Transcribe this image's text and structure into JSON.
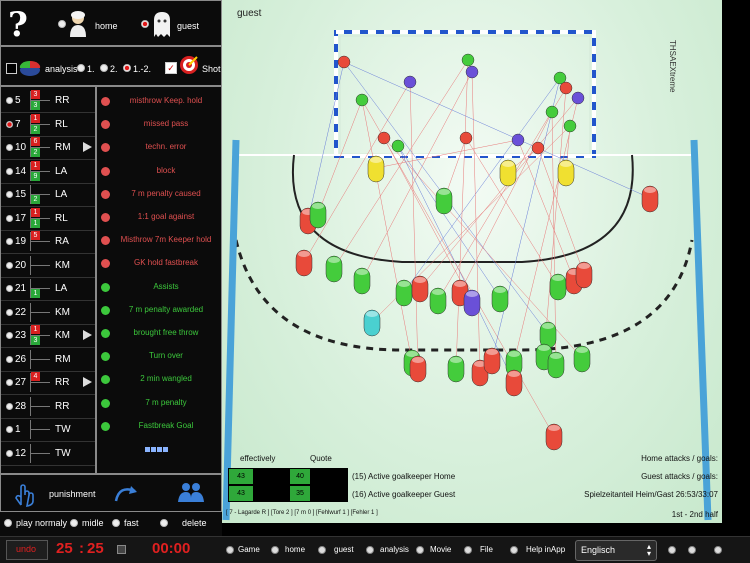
{
  "top": {
    "home_label": "home",
    "guest_label": "guest"
  },
  "options": {
    "analysis_label": "analysis",
    "opt1": "1.",
    "opt2": "2.",
    "opt3": "1.-2.",
    "shot_label": "Shot"
  },
  "players": [
    {
      "num": "5",
      "pos": "RR",
      "c1": "3",
      "c2": "3"
    },
    {
      "num": "7",
      "pos": "RL",
      "c1": "1",
      "c2": "2"
    },
    {
      "num": "10",
      "pos": "RM",
      "c1": "6",
      "c2": "2"
    },
    {
      "num": "14",
      "pos": "LA",
      "c1": "1",
      "c2": "9"
    },
    {
      "num": "15",
      "pos": "LA",
      "c1": "",
      "c2": "2"
    },
    {
      "num": "17",
      "pos": "RL",
      "c1": "1",
      "c2": "1"
    },
    {
      "num": "19",
      "pos": "RA",
      "c1": "5",
      "c2": ""
    },
    {
      "num": "20",
      "pos": "KM",
      "c1": "",
      "c2": ""
    },
    {
      "num": "21",
      "pos": "LA",
      "c1": "",
      "c2": "1"
    },
    {
      "num": "22",
      "pos": "KM",
      "c1": "",
      "c2": ""
    },
    {
      "num": "23",
      "pos": "KM",
      "c1": "1",
      "c2": "3"
    },
    {
      "num": "26",
      "pos": "RM",
      "c1": "",
      "c2": ""
    },
    {
      "num": "27",
      "pos": "RR",
      "c1": "4",
      "c2": ""
    },
    {
      "num": "28",
      "pos": "RR",
      "c1": "",
      "c2": ""
    },
    {
      "num": "1",
      "pos": "TW",
      "c1": "",
      "c2": ""
    },
    {
      "num": "12",
      "pos": "TW",
      "c1": "",
      "c2": ""
    }
  ],
  "actions": [
    {
      "label": "misthrow Keep. hold",
      "color": "#e05050"
    },
    {
      "label": "missed pass",
      "color": "#e05050"
    },
    {
      "label": "techn. error",
      "color": "#e05050"
    },
    {
      "label": "block",
      "color": "#e05050"
    },
    {
      "label": "7 m penalty caused",
      "color": "#e05050"
    },
    {
      "label": "1:1 goal against",
      "color": "#e05050"
    },
    {
      "label": "Misthrow 7m Keeper hold",
      "color": "#e05050"
    },
    {
      "label": "GK hold fastbreak",
      "color": "#e05050"
    },
    {
      "label": "Assists",
      "color": "#3cc83c"
    },
    {
      "label": "7 m penalty awarded",
      "color": "#3cc83c"
    },
    {
      "label": "brought free throw",
      "color": "#3cc83c"
    },
    {
      "label": "Turn over",
      "color": "#3cc83c"
    },
    {
      "label": "2 min wangled",
      "color": "#3cc83c"
    },
    {
      "label": "7 m penalty",
      "color": "#3cc83c"
    },
    {
      "label": "Fastbreak Goal",
      "color": "#3cc83c"
    }
  ],
  "bottom_left": {
    "punishment": "punishment",
    "play_normal": "play normaly",
    "midle": "midle",
    "fast": "fast",
    "delete": "delete"
  },
  "score": {
    "undo": "undo",
    "home": "25",
    "sep": ":",
    "guest": "25",
    "time": "00:00"
  },
  "field": {
    "title": "guest",
    "watermark": "THSAEXtreme",
    "effectively": "effectively",
    "quote": "Quote",
    "q1": "43",
    "q2": "40",
    "q3": "43",
    "q4": "35",
    "gk_home": "(15) Active goalkeeper Home",
    "gk_guest": "(16) Active goalkeeper Guest",
    "home_attacks": "Home attacks / goals:",
    "guest_attacks": "Guest attacks / goals:",
    "share": "Spielzeitanteil Heim/Gast 26:53/33:07",
    "stats_line": "[ 7 - Lagarde R ] [Tore 2 ] [7 m 0 ] [Fehlwurf 1 ] [Fehler 1 ]",
    "half": "1st - 2nd half"
  },
  "nav": {
    "game": "Game",
    "home": "home",
    "guest": "guest",
    "analysis": "analysis",
    "movie": "Movie",
    "file": "File",
    "help": "Help inApp",
    "language": "Englisch"
  },
  "colors": {
    "field_accent": "#4aa3d8",
    "red_player": "#e84a3a",
    "green_player": "#44cc3c",
    "blue_player": "#6a50d8",
    "yellow_player": "#f0e030"
  }
}
